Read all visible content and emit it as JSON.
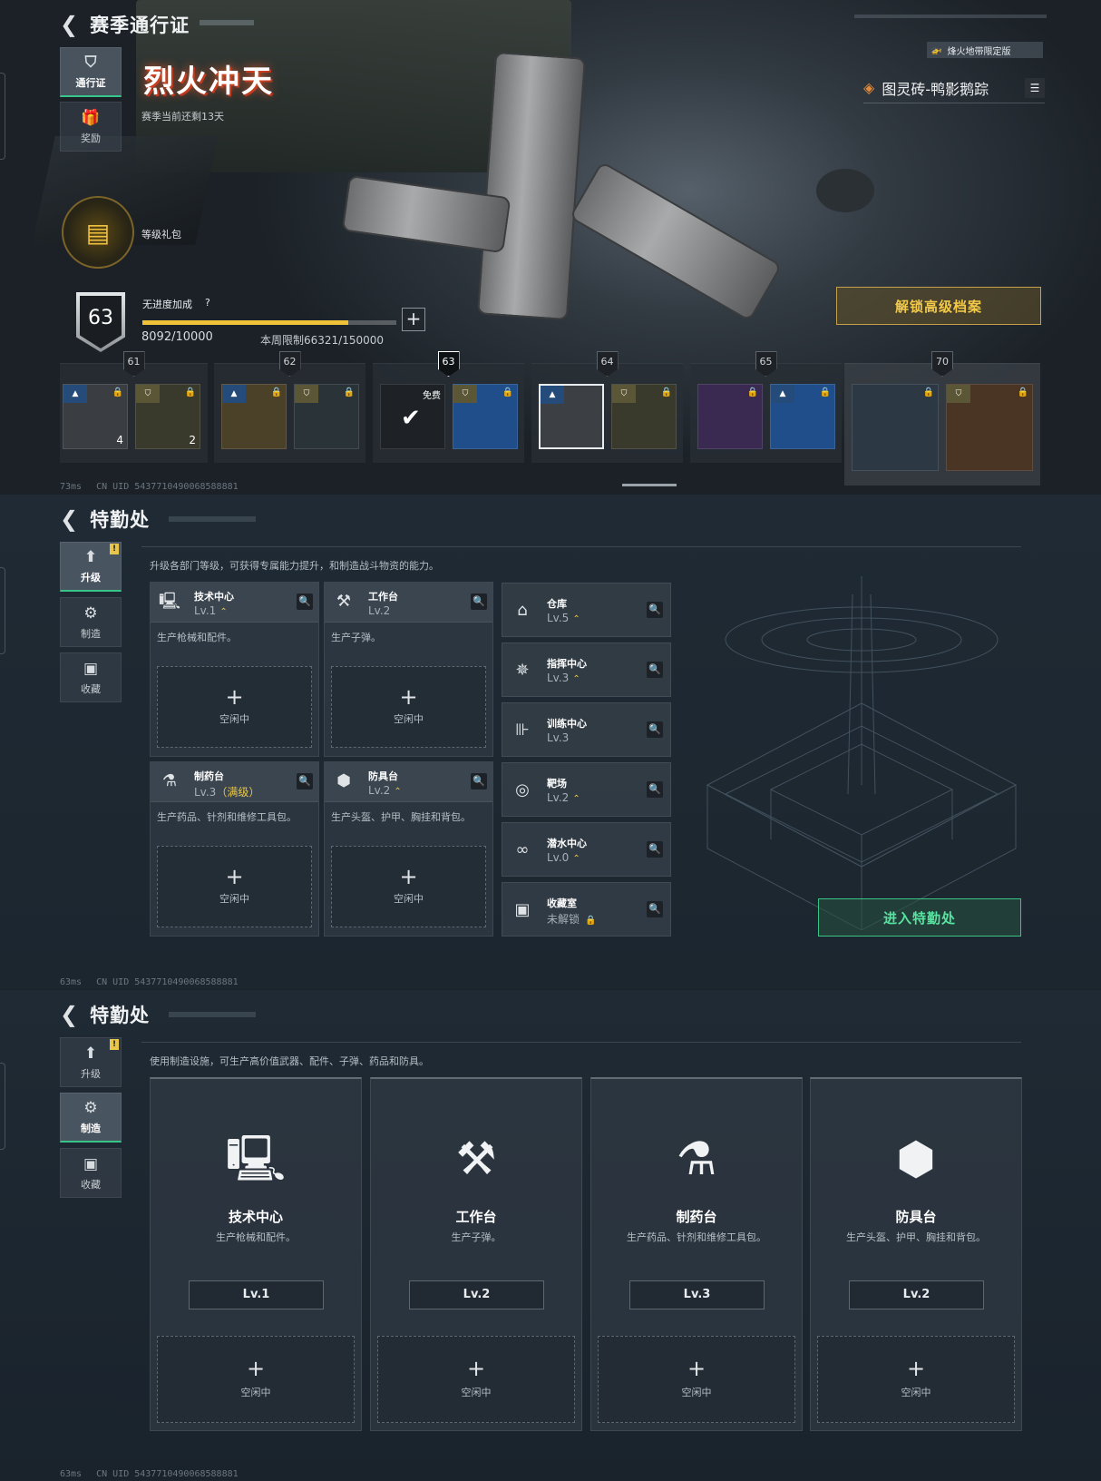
{
  "pass": {
    "back_title": "赛季通行证",
    "season_name": "烈火冲天",
    "season_remaining": "赛季当前还剩13天",
    "tabs": [
      {
        "label": "通行证",
        "icon": "pass-icon"
      },
      {
        "label": "奖励",
        "icon": "gift-icon"
      }
    ],
    "level_gift_label": "等级礼包",
    "edition_badge": "烽火地带限定版",
    "cosmetic_name": "图灵砖-鸭影鹅踪",
    "level": "63",
    "bonus_label": "无进度加成",
    "bonus_help": "?",
    "xp_text": "8092/10000",
    "xp_progress": 0.81,
    "weekly_limit": "本周限制66321/150000",
    "unlock_button": "解锁高级档案",
    "tiers": [
      {
        "level": "61",
        "items": [
          {
            "count": "4",
            "locked": true,
            "tag": "blue"
          },
          {
            "count": "2",
            "locked": true,
            "tag": "gold"
          }
        ]
      },
      {
        "level": "62",
        "items": [
          {
            "count": "",
            "locked": true,
            "tag": "blue"
          },
          {
            "count": "",
            "locked": true,
            "tag": "gold"
          }
        ]
      },
      {
        "level": "63",
        "free_label": "免费",
        "items": [
          {
            "count": "",
            "locked": false,
            "claimed": true
          },
          {
            "count": "",
            "locked": true,
            "tag": "gold"
          }
        ]
      },
      {
        "level": "64",
        "items": [
          {
            "count": "",
            "locked": false,
            "tag": "blue"
          },
          {
            "count": "",
            "locked": true,
            "tag": "gold"
          }
        ]
      },
      {
        "level": "65",
        "items": [
          {
            "count": "",
            "locked": true,
            "tag": ""
          },
          {
            "count": "",
            "locked": true,
            "tag": "blue"
          }
        ]
      },
      {
        "level": "70",
        "items": [
          {
            "count": "",
            "locked": true
          },
          {
            "count": "",
            "locked": true,
            "tag": "gold"
          }
        ]
      }
    ],
    "ping": "73ms",
    "uid": "CN UID 5437710490068588881"
  },
  "ops1": {
    "back_title": "特勤处",
    "tabs": [
      {
        "label": "升级",
        "icon": "upgrade-icon"
      },
      {
        "label": "制造",
        "icon": "gears-icon"
      },
      {
        "label": "收藏",
        "icon": "collection-icon"
      }
    ],
    "notice": "!",
    "intro": "升级各部门等级，可获得专属能力提升，和制造战斗物资的能力。",
    "departments": [
      {
        "name": "技术中心",
        "level": "Lv.1",
        "max": "",
        "desc": "生产枪械和配件。",
        "slot": "空闲中",
        "icon": "monitor-icon",
        "glyph": "🖳"
      },
      {
        "name": "工作台",
        "level": "Lv.2",
        "max": "",
        "desc": "生产子弹。",
        "slot": "空闲中",
        "icon": "tools-icon",
        "glyph": "⚒"
      },
      {
        "name": "制药台",
        "level": "Lv.3",
        "max": "（满级）",
        "desc": "生产药品、针剂和维修工具包。",
        "slot": "空闲中",
        "icon": "microscope-icon",
        "glyph": "⚗"
      },
      {
        "name": "防具台",
        "level": "Lv.2",
        "max": "",
        "desc": "生产头盔、护甲、胸挂和背包。",
        "slot": "空闲中",
        "icon": "armor-icon",
        "glyph": "⬢"
      }
    ],
    "facilities": [
      {
        "name": "仓库",
        "level": "Lv.5",
        "icon": "warehouse-icon",
        "glyph": "⌂",
        "upgradable": true
      },
      {
        "name": "指挥中心",
        "level": "Lv.3",
        "icon": "command-icon",
        "glyph": "✵",
        "upgradable": true
      },
      {
        "name": "训练中心",
        "level": "Lv.3",
        "icon": "dumbbell-icon",
        "glyph": "⊪",
        "upgradable": false
      },
      {
        "name": "靶场",
        "level": "Lv.2",
        "icon": "target-icon",
        "glyph": "◎",
        "upgradable": true
      },
      {
        "name": "潜水中心",
        "level": "Lv.0",
        "icon": "goggles-icon",
        "glyph": "∞",
        "upgradable": true
      },
      {
        "name": "收藏室",
        "level": "未解锁",
        "icon": "vault-icon",
        "glyph": "▣",
        "upgradable": false,
        "locked": true
      }
    ],
    "enter_button": "进入特勤处",
    "ping": "63ms",
    "uid": "CN UID 5437710490068588881"
  },
  "ops2": {
    "back_title": "特勤处",
    "tabs": [
      {
        "label": "升级",
        "icon": "upgrade-icon"
      },
      {
        "label": "制造",
        "icon": "gears-icon"
      },
      {
        "label": "收藏",
        "icon": "collection-icon"
      }
    ],
    "notice": "!",
    "intro": "使用制造设施，可生产高价值武器、配件、子弹、药品和防具。",
    "stations": [
      {
        "name": "技术中心",
        "desc": "生产枪械和配件。",
        "level": "Lv.1",
        "slot": "空闲中",
        "icon": "monitor-icon",
        "glyph": "🖳"
      },
      {
        "name": "工作台",
        "desc": "生产子弹。",
        "level": "Lv.2",
        "slot": "空闲中",
        "icon": "tools-icon",
        "glyph": "⚒"
      },
      {
        "name": "制药台",
        "desc": "生产药品、针剂和维修工具包。",
        "level": "Lv.3",
        "slot": "空闲中",
        "icon": "microscope-icon",
        "glyph": "⚗"
      },
      {
        "name": "防具台",
        "desc": "生产头盔、护甲、胸挂和背包。",
        "level": "Lv.2",
        "slot": "空闲中",
        "icon": "armor-icon",
        "glyph": "⬢"
      }
    ],
    "ping": "63ms",
    "uid": "CN UID 5437710490068588881"
  }
}
